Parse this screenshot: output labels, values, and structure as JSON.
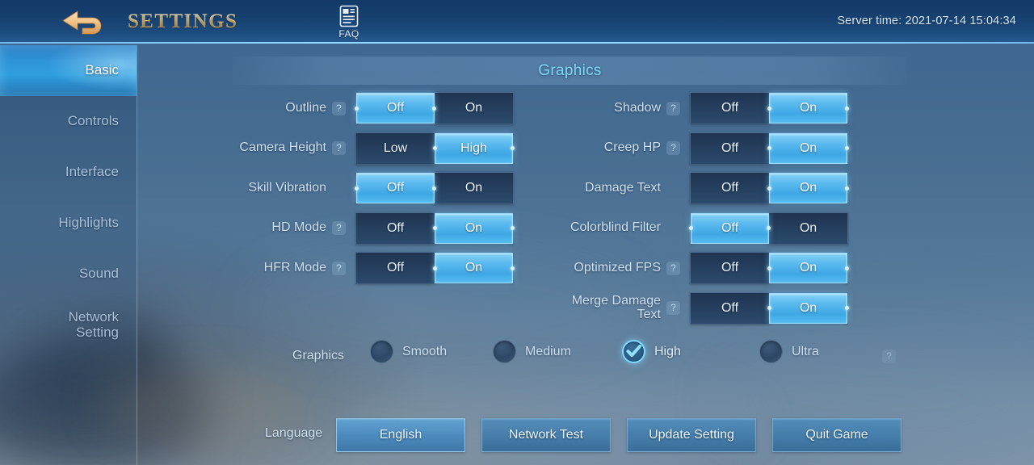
{
  "header": {
    "back_icon": "back-arrow-icon",
    "title": "SETTINGS",
    "faq_icon": "faq-document-icon",
    "faq_label": "FAQ",
    "server_time": "Server time: 2021-07-14 15:04:34"
  },
  "sidebar": {
    "items": [
      {
        "label": "Basic",
        "active": true
      },
      {
        "label": "Controls",
        "active": false
      },
      {
        "label": "Interface",
        "active": false
      },
      {
        "label": "Highlights",
        "active": false
      },
      {
        "label": "Sound",
        "active": false
      },
      {
        "label": "Network\nSetting",
        "active": false
      }
    ]
  },
  "main": {
    "section_title": "Graphics",
    "help_badge": "?",
    "left_options": [
      {
        "label": "Outline",
        "help": true,
        "options": [
          "Off",
          "On"
        ],
        "selected": 0
      },
      {
        "label": "Camera Height",
        "help": true,
        "options": [
          "Low",
          "High"
        ],
        "selected": 1
      },
      {
        "label": "Skill Vibration",
        "help": false,
        "options": [
          "Off",
          "On"
        ],
        "selected": 0
      },
      {
        "label": "HD Mode",
        "help": true,
        "options": [
          "Off",
          "On"
        ],
        "selected": 1
      },
      {
        "label": "HFR Mode",
        "help": true,
        "options": [
          "Off",
          "On"
        ],
        "selected": 1
      }
    ],
    "right_options": [
      {
        "label": "Shadow",
        "help": true,
        "options": [
          "Off",
          "On"
        ],
        "selected": 1
      },
      {
        "label": "Creep HP",
        "help": true,
        "options": [
          "Off",
          "On"
        ],
        "selected": 1
      },
      {
        "label": "Damage Text",
        "help": false,
        "options": [
          "Off",
          "On"
        ],
        "selected": 1
      },
      {
        "label": "Colorblind Filter",
        "help": false,
        "options": [
          "Off",
          "On"
        ],
        "selected": 0
      },
      {
        "label": "Optimized FPS",
        "help": true,
        "options": [
          "Off",
          "On"
        ],
        "selected": 1
      },
      {
        "label": "Merge Damage Text",
        "help": true,
        "options": [
          "Off",
          "On"
        ],
        "selected": 1
      }
    ],
    "quality": {
      "title": "Graphics",
      "options": [
        "Smooth",
        "Medium",
        "High",
        "Ultra"
      ],
      "selected": 2,
      "help": "?"
    },
    "bottom": {
      "language_label": "Language",
      "buttons": [
        {
          "label": "English",
          "primary": true
        },
        {
          "label": "Network Test",
          "primary": false
        },
        {
          "label": "Update Setting",
          "primary": false
        },
        {
          "label": "Quit Game",
          "primary": false
        }
      ]
    }
  },
  "colors": {
    "accent_cyan": "#7fd6f5",
    "toggle_active": "#59b9ef",
    "title_gold": "#f0c97a",
    "panel_blue": "#3d6591",
    "topbar_blue": "#16406f"
  }
}
